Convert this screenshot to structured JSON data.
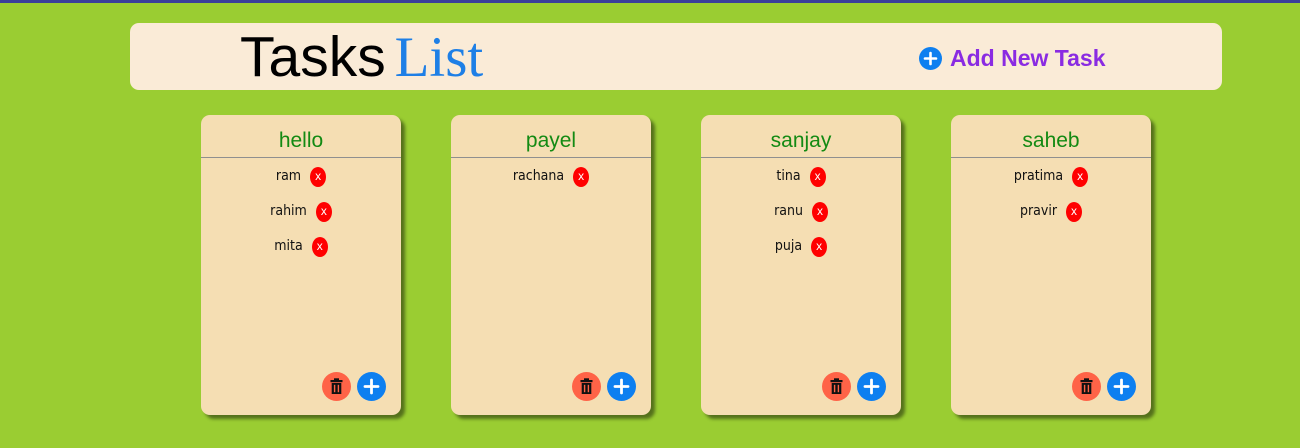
{
  "header": {
    "title_word1": "Tasks",
    "title_word2": "List",
    "add_task_label": "Add New Task"
  },
  "icons": {
    "add": "plus-circle-icon",
    "delete": "trash-icon",
    "remove": "x-icon"
  },
  "colors": {
    "background": "#9acd32",
    "header_bg": "#faebd7",
    "card_bg": "#f5deb3",
    "card_title": "#138a13",
    "accent_blue": "#0d7ff0",
    "add_task_text": "#8a2be2",
    "delete_btn": "#ff6347",
    "remove_btn": "#ff0000"
  },
  "cards": [
    {
      "title": "hello",
      "items": [
        {
          "label": "ram",
          "remove": "x"
        },
        {
          "label": "rahim",
          "remove": "x"
        },
        {
          "label": "mita",
          "remove": "x"
        }
      ]
    },
    {
      "title": "payel",
      "items": [
        {
          "label": "rachana",
          "remove": "x"
        }
      ]
    },
    {
      "title": "sanjay",
      "items": [
        {
          "label": "tina",
          "remove": "x"
        },
        {
          "label": "ranu",
          "remove": "x"
        },
        {
          "label": "puja",
          "remove": "x"
        }
      ]
    },
    {
      "title": "saheb",
      "items": [
        {
          "label": "pratima",
          "remove": "x"
        },
        {
          "label": "pravir",
          "remove": "x"
        }
      ]
    }
  ]
}
